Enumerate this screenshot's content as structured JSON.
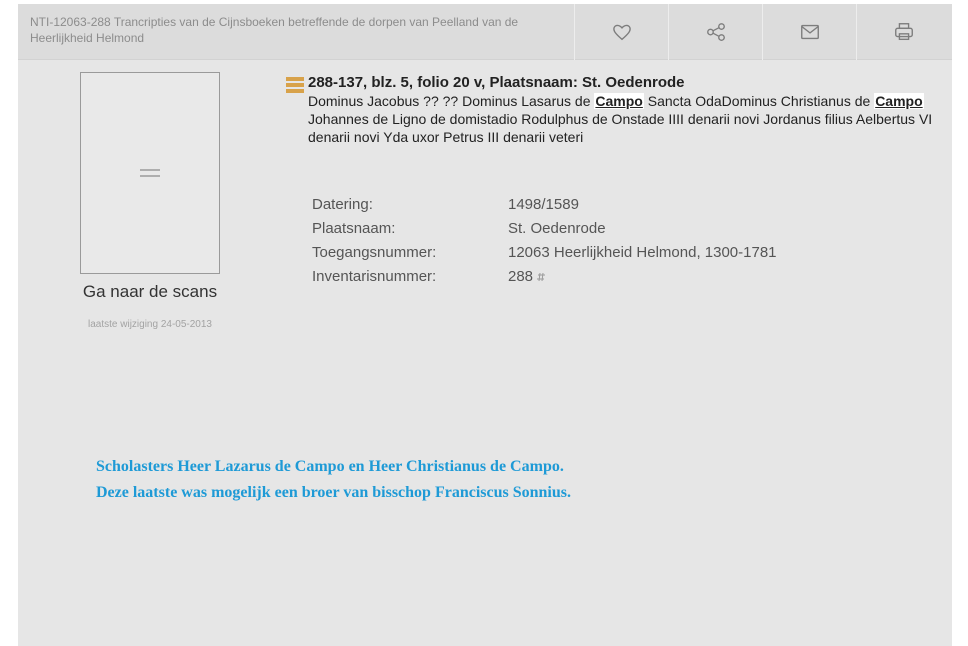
{
  "header": {
    "title": "NTI-12063-288 Trancripties van de Cijnsboeken betreffende de dorpen van Peelland van de Heerlijkheid Helmond",
    "tools": [
      {
        "name": "favorite",
        "icon": "heart-icon"
      },
      {
        "name": "share",
        "icon": "share-icon"
      },
      {
        "name": "email",
        "icon": "mail-icon"
      },
      {
        "name": "print",
        "icon": "printer-icon"
      }
    ]
  },
  "sidebar": {
    "scans_link": "Ga naar de scans",
    "last_modified": "laatste wijziging 24-05-2013"
  },
  "record": {
    "heading": "288-137, blz. 5, folio 20 v, Plaatsnaam: St. Oedenrode",
    "description_parts": [
      "Dominus Jacobus ?? ?? Dominus Lasarus de ",
      "Campo",
      " Sancta OdaDominus Christianus de ",
      "Campo",
      " Johannes de Ligno de domistadio Rodulphus de Onstade IIII denarii novi Jordanus filius Aelbertus VI denarii novi Yda uxor Petrus III denarii veteri"
    ],
    "fields": [
      {
        "label": "Datering:",
        "value": "1498/1589"
      },
      {
        "label": "Plaatsnaam:",
        "value": "St. Oedenrode"
      },
      {
        "label": "Toegangsnummer:",
        "value": "12063 Heerlijkheid Helmond, 1300-1781"
      },
      {
        "label": "Inventarisnummer:",
        "value": "288"
      }
    ]
  },
  "note": {
    "line1": "Scholasters Heer Lazarus de Campo en Heer Christianus de Campo.",
    "line2": "Deze laatste was mogelijk een broer van bisschop Franciscus Sonnius."
  },
  "colors": {
    "note": "#1e9ad6",
    "panel": "#e6e6e6",
    "topbar": "#dcdcdc",
    "record_icon": "#d8a24a"
  }
}
